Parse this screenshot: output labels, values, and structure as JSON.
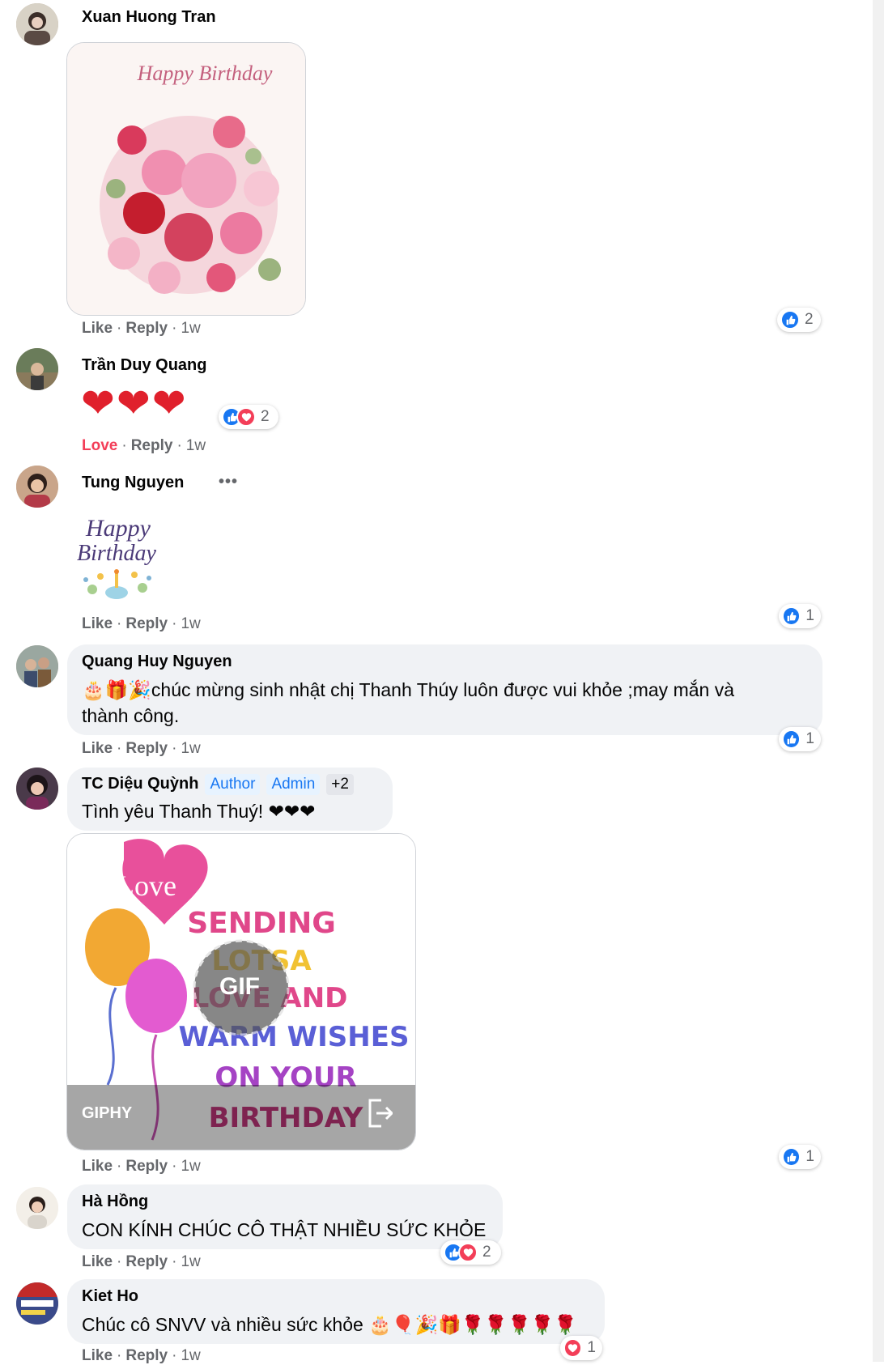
{
  "comments": [
    {
      "name": "Xuan Huong Tran",
      "image_text": "Happy Birthday",
      "actions": [
        "Like",
        "Reply",
        "1w"
      ],
      "reactions": "2"
    },
    {
      "name": "Trần Duy Quang",
      "text": "❤❤❤",
      "actions": [
        "Love",
        "Reply",
        "1w"
      ],
      "reactions": "2"
    },
    {
      "name": "Tung Nguyen",
      "more": "•••",
      "sticker_text": [
        "Happy",
        "Birthday"
      ],
      "actions": [
        "Like",
        "Reply",
        "1w"
      ],
      "reactions": "1"
    },
    {
      "name": "Quang Huy Nguyen",
      "text_line1": "🎂🎁🎉chúc mừng sinh nhật chị Thanh Thúy luôn được vui khỏe ;may mắn và",
      "text_line2": "thành công.",
      "actions": [
        "Like",
        "Reply",
        "1w"
      ],
      "reactions": "1"
    },
    {
      "name": "TC Diệu Quỳnh",
      "badges": [
        "Author",
        "Admin",
        "+2"
      ],
      "text": "Tình yêu Thanh Thuý! ❤❤❤",
      "gif": {
        "label": "GIF",
        "provider": "GIPHY",
        "lines": [
          "Love",
          "SENDING",
          "LOTSA",
          "LOVE AND",
          "WARM WISHES",
          "ON YOUR",
          "BIRTHDAY"
        ]
      },
      "actions": [
        "Like",
        "Reply",
        "1w"
      ],
      "reactions": "1"
    },
    {
      "name": "Hà Hồng",
      "text": "CON KÍNH CHÚC CÔ THẬT NHIỀU SỨC KHỎE",
      "actions": [
        "Like",
        "Reply",
        "1w"
      ],
      "reactions": "2"
    },
    {
      "name": "Kiet Ho",
      "text": "Chúc cô SNVV và nhiều sức khỏe 🎂🎈🎉🎁🌹🌹🌹🌹🌹",
      "actions": [
        "Like",
        "Reply",
        "1w"
      ],
      "reactions": "1"
    }
  ],
  "colors": {
    "like_blue": "#1877f2",
    "love_red": "#f33e58",
    "bubble_bg": "#f0f2f5",
    "meta_gray": "#65676b"
  }
}
